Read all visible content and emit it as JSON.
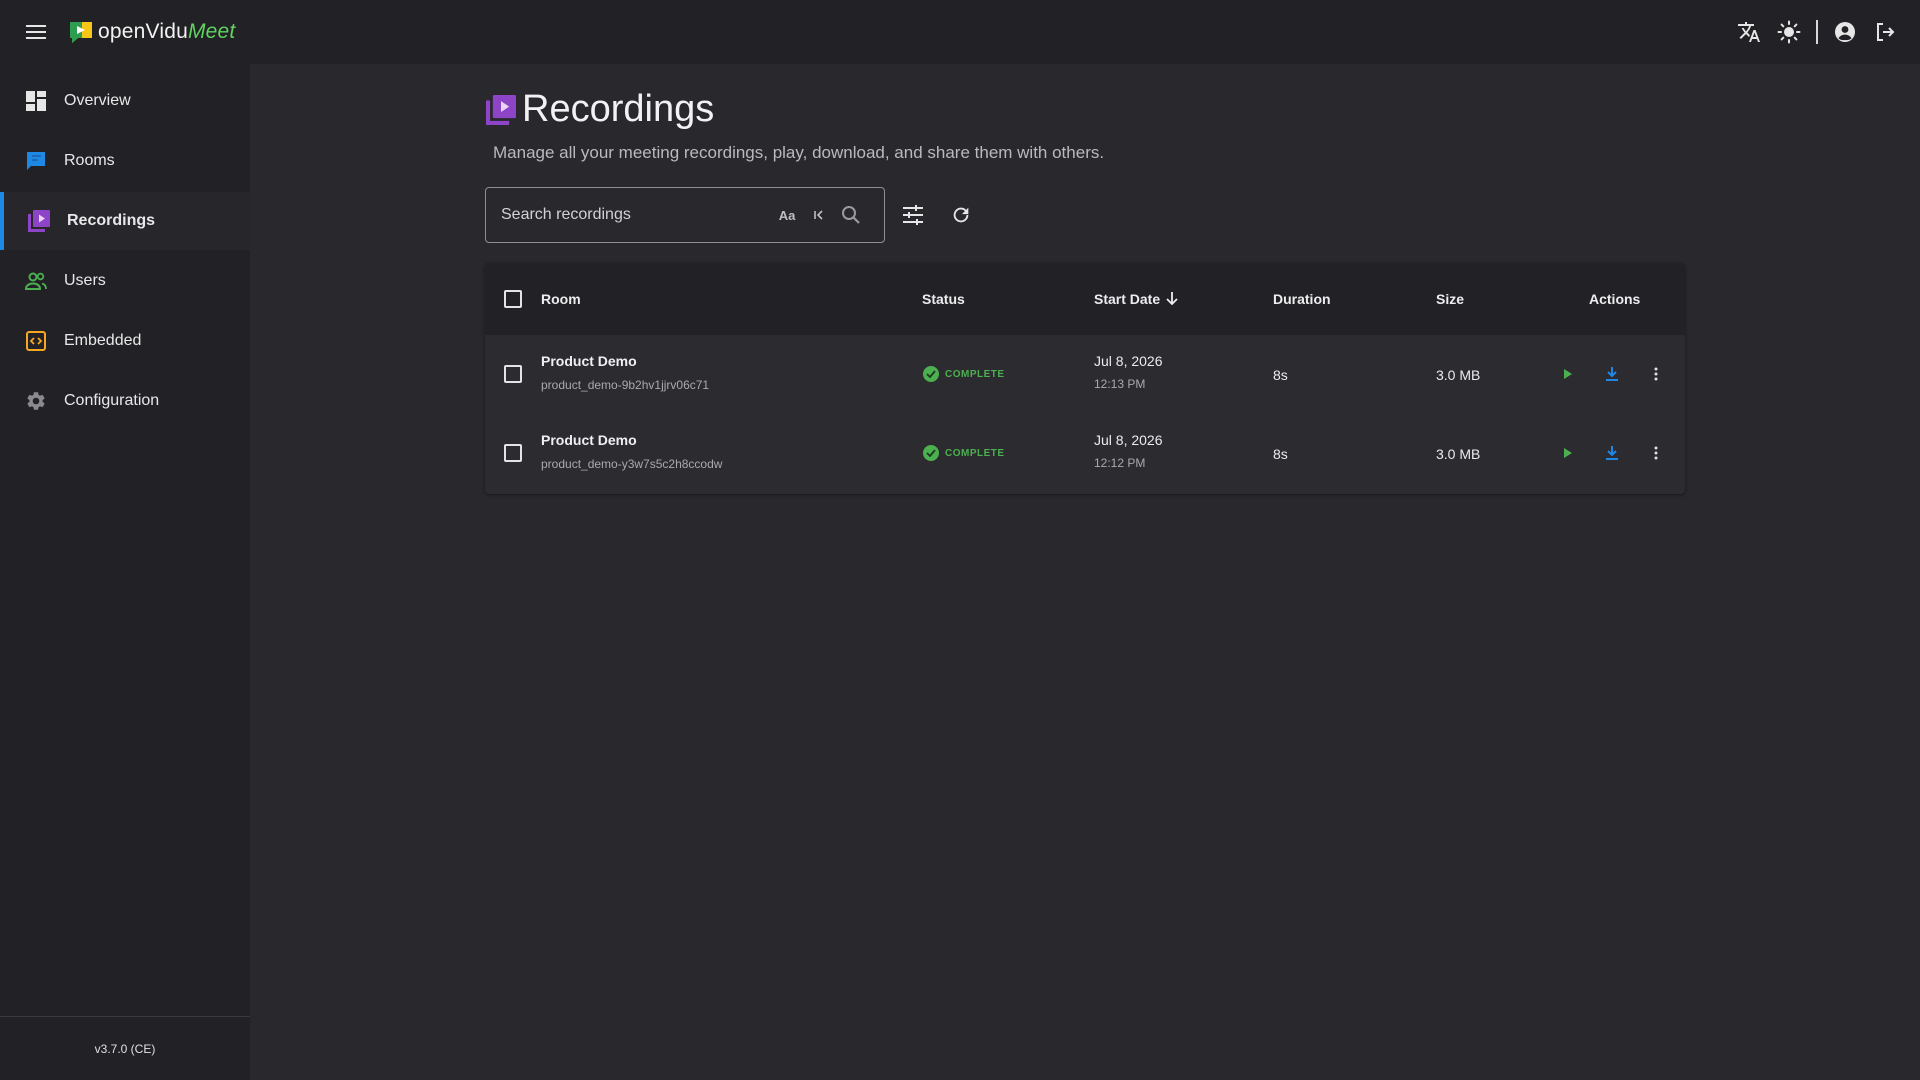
{
  "app": {
    "brand_part1": "openVidu",
    "brand_part2": "Meet"
  },
  "topbar": {
    "icons": [
      "menu-icon",
      "translate-icon",
      "light-mode-icon",
      "account-icon",
      "logout-icon"
    ]
  },
  "sidebar": {
    "items": [
      {
        "label": "Overview",
        "icon": "dashboard-icon"
      },
      {
        "label": "Rooms",
        "icon": "chat-icon"
      },
      {
        "label": "Recordings",
        "icon": "video-library-icon",
        "active": true
      },
      {
        "label": "Users",
        "icon": "people-icon"
      },
      {
        "label": "Embedded",
        "icon": "code-icon"
      },
      {
        "label": "Configuration",
        "icon": "gear-icon"
      }
    ],
    "version": "v3.7.0 (CE)"
  },
  "page": {
    "title": "Recordings",
    "subtitle": "Manage all your meeting recordings, play, download, and share them with others."
  },
  "search": {
    "placeholder": "Search recordings",
    "value": "",
    "match_case_label": "Aa"
  },
  "table": {
    "columns": {
      "room": "Room",
      "status": "Status",
      "start_date": "Start Date",
      "duration": "Duration",
      "size": "Size",
      "actions": "Actions"
    },
    "sort": {
      "column": "Start Date",
      "direction": "descending"
    },
    "rows": [
      {
        "room": "Product Demo",
        "room_id": "product_demo-9b2hv1jjrv06c71",
        "status": "COMPLETE",
        "date": "Jul 8, 2026",
        "time": "12:13 PM",
        "duration": "8s",
        "size": "3.0 MB"
      },
      {
        "room": "Product Demo",
        "room_id": "product_demo-y3w7s5c2h8ccodw",
        "status": "COMPLETE",
        "date": "Jul 8, 2026",
        "time": "12:12 PM",
        "duration": "8s",
        "size": "3.0 MB"
      }
    ]
  },
  "colors": {
    "background": "#28282d",
    "panel": "#222226",
    "accent_blue": "#1e88e5",
    "recordings_purple": "#8e44c7",
    "success_green": "#4caf50"
  }
}
